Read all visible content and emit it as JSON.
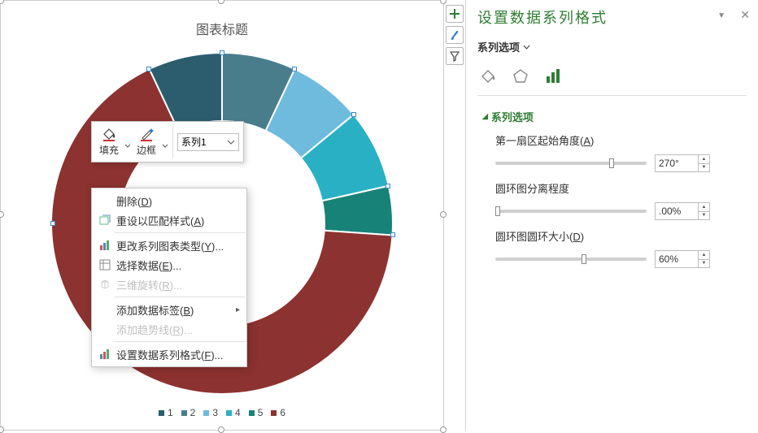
{
  "chart_data": {
    "type": "pie",
    "title": "图表标题",
    "subtype": "doughnut",
    "hole_size": 0.6,
    "start_angle_deg": 270,
    "explosion": 0,
    "categories": [
      "1",
      "2",
      "3",
      "4",
      "5",
      "6"
    ],
    "values": [
      7,
      7,
      7,
      7,
      7,
      65
    ],
    "colors": [
      "#2B5D6E",
      "#4A7D8C",
      "#6FBBDD",
      "#2AB0C5",
      "#178277",
      "#8C3230"
    ],
    "legend_position": "bottom"
  },
  "legend": [
    {
      "label": "1",
      "color": "#2B5D6E"
    },
    {
      "label": "2",
      "color": "#4A7D8C"
    },
    {
      "label": "3",
      "color": "#6FBBDD"
    },
    {
      "label": "4",
      "color": "#2AB0C5"
    },
    {
      "label": "5",
      "color": "#178277"
    },
    {
      "label": "6",
      "color": "#8C3230"
    }
  ],
  "mini_toolbar": {
    "fill_label": "填充",
    "outline_label": "边框",
    "series_selected": "系列1"
  },
  "context_menu": {
    "delete": "删除",
    "delete_k": "D",
    "reset": "重设以匹配样式",
    "reset_k": "A",
    "change_type": "更改系列图表类型",
    "change_type_k": "Y",
    "select_data": "选择数据",
    "select_data_k": "E",
    "rotate_3d": "三维旋转",
    "rotate_3d_k": "R",
    "add_labels": "添加数据标签",
    "add_labels_k": "B",
    "add_trend": "添加趋势线",
    "add_trend_k": "R",
    "format_series": "设置数据系列格式",
    "format_series_k": "F"
  },
  "format_pane": {
    "title": "设置数据系列格式",
    "subtitle": "系列选项",
    "section": "系列选项",
    "field1_label_a": "第一扇区起始角度",
    "field1_label_b": "A",
    "field1_value": "270°",
    "field2_label": "圆环图分离程度",
    "field2_value": ".00%",
    "field3_label_a": "圆环图圆环大小",
    "field3_label_b": "D",
    "field3_value": "60%"
  }
}
